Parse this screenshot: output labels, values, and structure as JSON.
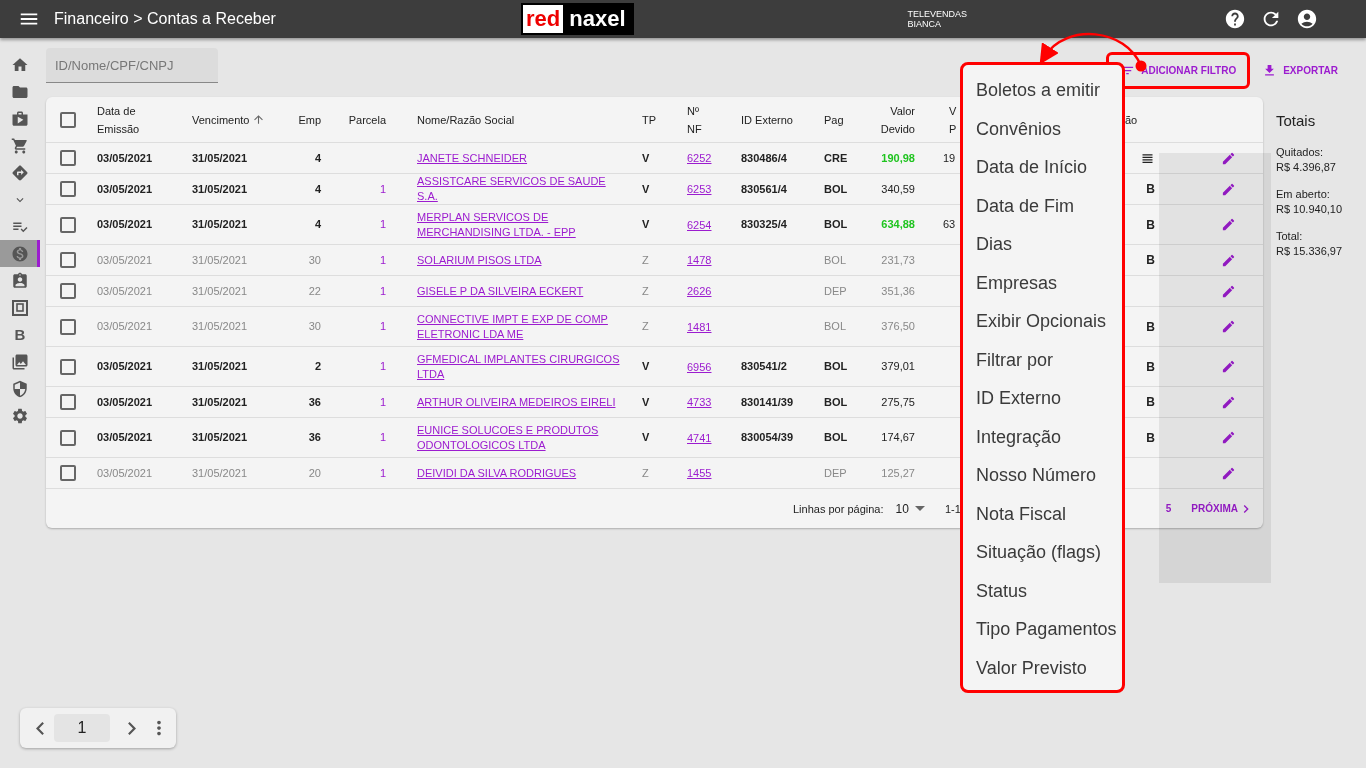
{
  "topbar": {
    "title": "Financeiro > Contas a Receber",
    "logo": {
      "left": "red",
      "right": "naxel"
    },
    "user": {
      "team": "TELEVENDAS",
      "name": "BIANCA"
    }
  },
  "sidebar": {
    "items": [
      {
        "kind": "icon",
        "selected": false
      },
      {
        "kind": "icon",
        "selected": false
      },
      {
        "kind": "icon",
        "selected": false
      },
      {
        "kind": "icon",
        "selected": false
      },
      {
        "kind": "icon",
        "selected": false
      },
      {
        "kind": "icon",
        "selected": false
      },
      {
        "kind": "icon",
        "selected": false
      },
      {
        "kind": "icon",
        "selected": true
      },
      {
        "kind": "icon",
        "selected": false
      },
      {
        "kind": "icon",
        "selected": false
      },
      {
        "kind": "text",
        "label": "B",
        "selected": false
      },
      {
        "kind": "icon",
        "selected": false
      },
      {
        "kind": "icon",
        "selected": false
      },
      {
        "kind": "icon",
        "selected": false
      }
    ]
  },
  "search": {
    "placeholder": "ID/Nome/CPF/CNPJ"
  },
  "actions": [
    {
      "label": "ADICIONAR FILTRO",
      "kind": "filter",
      "highlighted": true
    },
    {
      "label": "EXPORTAR",
      "kind": "export",
      "highlighted": false
    }
  ],
  "table": {
    "select_all_checked": false,
    "columns": [
      {
        "label": "Data de\nEmissão",
        "sorted": false
      },
      {
        "label": "Vencimento",
        "sorted": true
      },
      {
        "label": "Emp",
        "sorted": false
      },
      {
        "label": "Parcela",
        "sorted": false
      },
      {
        "label": "Nome/Razão Social",
        "sorted": false
      },
      {
        "label": "TP",
        "sorted": false
      },
      {
        "label": "Nº\nNF",
        "sorted": false
      },
      {
        "label": "ID Externo",
        "sorted": false
      },
      {
        "label": "Pag",
        "sorted": false
      },
      {
        "label": "Valor\nDevido",
        "sorted": false
      },
      {
        "label": "V\nP",
        "sorted": false
      },
      {
        "label": "ão",
        "sorted": false
      }
    ],
    "rows": [
      {
        "checked": false,
        "emissao": "03/05/2021",
        "vencimento": "31/05/2021",
        "emp": "4",
        "parcela": "",
        "nome": "JANETE SCHNEIDER",
        "tp": "V",
        "nf": "6252",
        "id_externo": "830486/4",
        "pag": "CRE",
        "valor_devido": "190,98",
        "valor_previsto": "19",
        "paid": true,
        "inactive": false,
        "notes_icon": true
      },
      {
        "checked": false,
        "emissao": "03/05/2021",
        "vencimento": "31/05/2021",
        "emp": "4",
        "parcela": "1",
        "nome": "ASSISTCARE SERVICOS DE SAUDE S.A.",
        "tp": "V",
        "nf": "6253",
        "id_externo": "830561/4",
        "pag": "BOL",
        "valor_devido": "340,59",
        "paid": false,
        "inactive": false,
        "notes_icon": false,
        "flag": "B"
      },
      {
        "checked": false,
        "emissao": "03/05/2021",
        "vencimento": "31/05/2021",
        "emp": "4",
        "parcela": "1",
        "nome": "MERPLAN SERVICOS DE MERCHANDISING LTDA. - EPP",
        "tp": "V",
        "nf": "6254",
        "id_externo": "830325/4",
        "pag": "BOL",
        "valor_devido": "634,88",
        "valor_previsto": "63",
        "paid": true,
        "inactive": false,
        "notes_icon": false,
        "flag": "B"
      },
      {
        "checked": false,
        "emissao": "03/05/2021",
        "vencimento": "31/05/2021",
        "emp": "30",
        "parcela": "1",
        "nome": "SOLARIUM PISOS LTDA",
        "tp": "Z",
        "nf": "1478",
        "pag": "BOL",
        "valor_devido": "231,73",
        "paid": false,
        "inactive": true,
        "notes_icon": false,
        "flag": "B"
      },
      {
        "checked": false,
        "emissao": "03/05/2021",
        "vencimento": "31/05/2021",
        "emp": "22",
        "parcela": "1",
        "nome": "GISELE P DA SILVEIRA ECKERT",
        "tp": "Z",
        "nf": "2626",
        "pag": "DEP",
        "valor_devido": "351,36",
        "paid": false,
        "inactive": true,
        "notes_icon": false
      },
      {
        "checked": false,
        "emissao": "03/05/2021",
        "vencimento": "31/05/2021",
        "emp": "30",
        "parcela": "1",
        "nome": "CONNECTIVE IMPT E EXP DE COMP ELETRONIC LDA ME",
        "tp": "Z",
        "nf": "1481",
        "pag": "BOL",
        "valor_devido": "376,50",
        "paid": false,
        "inactive": true,
        "notes_icon": false,
        "flag": "B"
      },
      {
        "checked": false,
        "emissao": "03/05/2021",
        "vencimento": "31/05/2021",
        "emp": "2",
        "parcela": "1",
        "nome": "GFMEDICAL IMPLANTES CIRURGICOS LTDA",
        "tp": "V",
        "nf": "6956",
        "id_externo": "830541/2",
        "pag": "BOL",
        "valor_devido": "379,01",
        "paid": false,
        "inactive": false,
        "notes_icon": false,
        "flag": "B"
      },
      {
        "checked": false,
        "emissao": "03/05/2021",
        "vencimento": "31/05/2021",
        "emp": "36",
        "parcela": "1",
        "nome": "ARTHUR OLIVEIRA MEDEIROS EIRELI",
        "tp": "V",
        "nf": "4733",
        "id_externo": "830141/39",
        "pag": "BOL",
        "valor_devido": "275,75",
        "paid": false,
        "inactive": false,
        "notes_icon": false,
        "flag": "B"
      },
      {
        "checked": false,
        "emissao": "03/05/2021",
        "vencimento": "31/05/2021",
        "emp": "36",
        "parcela": "1",
        "nome": "EUNICE SOLUCOES E PRODUTOS ODONTOLOGICOS LTDA",
        "tp": "V",
        "nf": "4741",
        "id_externo": "830054/39",
        "pag": "BOL",
        "valor_devido": "174,67",
        "paid": false,
        "inactive": false,
        "notes_icon": false,
        "flag": "B"
      },
      {
        "checked": false,
        "emissao": "03/05/2021",
        "vencimento": "31/05/2021",
        "emp": "20",
        "parcela": "1",
        "nome": "DEIVIDI DA SILVA RODRIGUES",
        "tp": "Z",
        "nf": "1455",
        "pag": "DEP",
        "valor_devido": "125,27",
        "paid": false,
        "inactive": true,
        "notes_icon": false
      }
    ],
    "footer": {
      "rows_label": "Linhas por página:",
      "rows_value": "10",
      "range": "1-1",
      "page": "5",
      "next": "PRÓXIMA"
    }
  },
  "totals": {
    "title": "Totais",
    "items": [
      {
        "label": "Quitados:",
        "value": "R$ 4.396,87"
      },
      {
        "label": "Em aberto:",
        "value": "R$ 10.940,10"
      },
      {
        "label": "Total:",
        "value": "R$ 15.336,97"
      }
    ]
  },
  "filter_menu": {
    "items": [
      "Boletos a emitir",
      "Convênios",
      "Data de Início",
      "Data de Fim",
      "Dias",
      "Empresas",
      "Exibir Opcionais",
      "Filtrar por",
      "ID Externo",
      "Integração",
      "Nosso Número",
      "Nota Fiscal",
      "Situação (flags)",
      "Status",
      "Tipo Pagamentos",
      "Valor Previsto"
    ]
  },
  "pager": {
    "page": "1"
  }
}
